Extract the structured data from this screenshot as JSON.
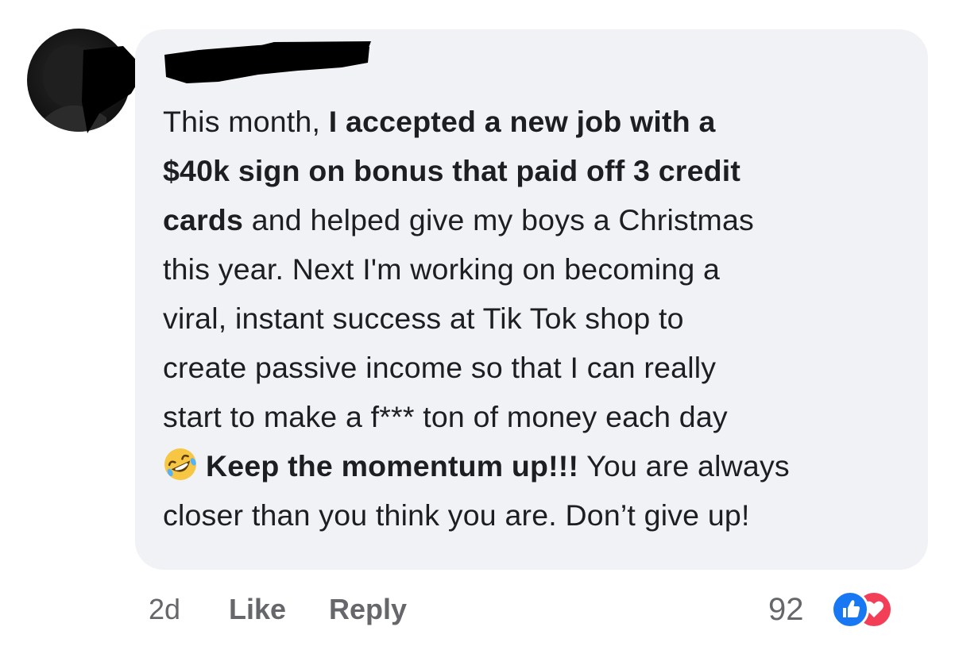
{
  "comment": {
    "lines": [
      [
        {
          "t": "This month, ",
          "b": false
        },
        {
          "t": "I accepted a new job with a",
          "b": true
        }
      ],
      [
        {
          "t": "$40k sign on bonus that paid off 3 credit",
          "b": true
        }
      ],
      [
        {
          "t": "cards",
          "b": true
        },
        {
          "t": " and helped give my boys a Christmas",
          "b": false
        }
      ],
      [
        {
          "t": "this year. Next I'm working on becoming a",
          "b": false
        }
      ],
      [
        {
          "t": "viral, instant success at Tik Tok shop to",
          "b": false
        }
      ],
      [
        {
          "t": "create passive income so that I can really",
          "b": false
        }
      ],
      [
        {
          "t": "start to make a f*** ton of money each day",
          "b": false
        }
      ],
      [
        {
          "emoji": "rolling-on-floor-laughing-emoji"
        },
        {
          "t": "Keep the momentum up!!!",
          "b": true
        },
        {
          "t": " You are always",
          "b": false
        }
      ],
      [
        {
          "t": "closer than you think you are. Don’t give up!",
          "b": false
        }
      ]
    ]
  },
  "meta": {
    "time": "2d",
    "like_label": "Like",
    "reply_label": "Reply"
  },
  "reactions": {
    "count": "92",
    "icons": [
      "like-reaction-icon",
      "love-reaction-icon"
    ]
  },
  "colors": {
    "bubble": "#f0f2f5",
    "text": "#1c1e21",
    "meta": "#65676b",
    "like_blue": "#1877f2",
    "love_red": "#f33e58"
  }
}
